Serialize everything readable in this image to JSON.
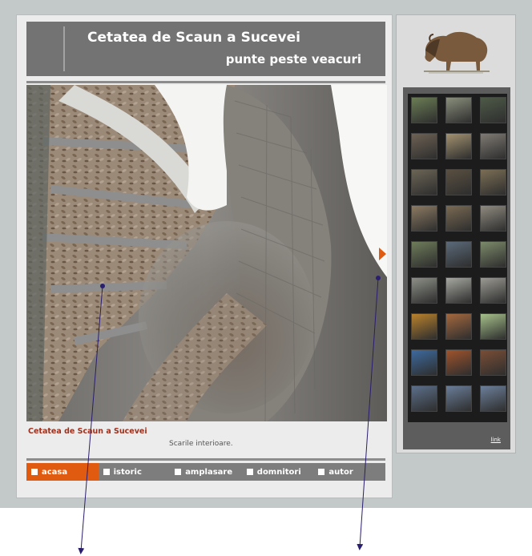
{
  "header": {
    "title": "Cetatea de Scaun a Sucevei",
    "subtitle": "punte peste veacuri"
  },
  "photo": {
    "caption_title": "Cetatea de Scaun a Sucevei",
    "caption_text": "Scarile interioare."
  },
  "nav": {
    "items": [
      {
        "label": "acasa",
        "active": true
      },
      {
        "label": "istoric"
      },
      {
        "label": "amplasare"
      },
      {
        "label": "domnitori"
      },
      {
        "label": "autor"
      }
    ]
  },
  "sidebar": {
    "link_label": "link",
    "thumb_colors": [
      "#6b7d55",
      "#8a8f7c",
      "#4e5a48",
      "#6e6254",
      "#a39270",
      "#7f7a73",
      "#6c6556",
      "#5a5041",
      "#7b6e55",
      "#8c7a62",
      "#7a6a53",
      "#908b80",
      "#6e7c5a",
      "#5b6a7a",
      "#7c8a6a",
      "#8d9087",
      "#a6a8a0",
      "#9b9a93",
      "#b9822c",
      "#a4683e",
      "#a6c08a",
      "#3d6a9e",
      "#a0542c",
      "#7a4e36",
      "#5c6f8a",
      "#6a7d99",
      "#6c7f9a"
    ]
  },
  "colors": {
    "accent": "#e05a10",
    "header_bg": "#737373",
    "caption_title": "#a0301c"
  }
}
